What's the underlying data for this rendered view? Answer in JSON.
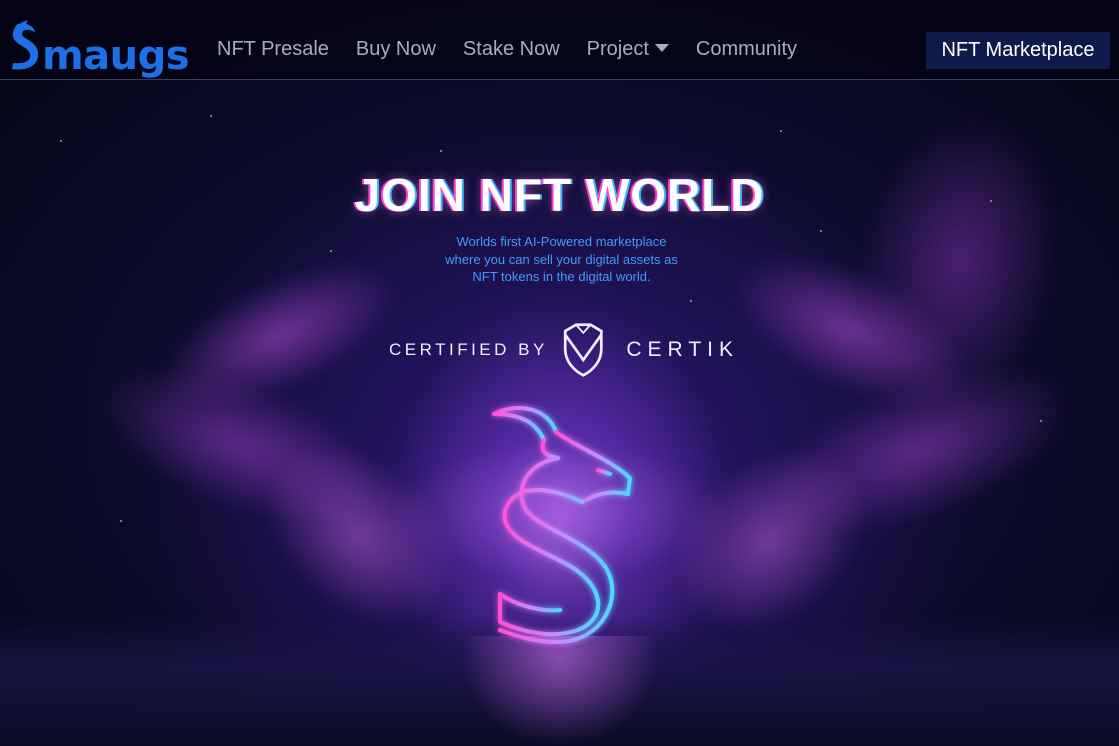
{
  "brand": {
    "logo_text": "maugs",
    "logo_mark": "S",
    "logo_color": "#1e6fe6"
  },
  "nav": {
    "items": [
      {
        "label": "NFT Presale"
      },
      {
        "label": "Buy Now"
      },
      {
        "label": "Stake Now"
      },
      {
        "label": "Project",
        "has_dropdown": true
      },
      {
        "label": "Community"
      }
    ],
    "cta_label": "NFT Marketplace"
  },
  "hero": {
    "title": "JOIN NFT WORLD",
    "subtitle_lines": [
      "Worlds first AI-Powered marketplace",
      "where you can sell your digital assets as",
      "NFT tokens in the digital world."
    ],
    "certified_label": "CERTIFIED BY",
    "certified_brand": "CERTIK",
    "emblem_icon": "neon-dragon-s-icon"
  },
  "colors": {
    "accent_blue": "#3f9bff",
    "nav_text": "#a8acbc",
    "cta_bg": "#0d1a4a",
    "neon_pink": "#ff3fd0",
    "neon_cyan": "#3fb7ff"
  }
}
